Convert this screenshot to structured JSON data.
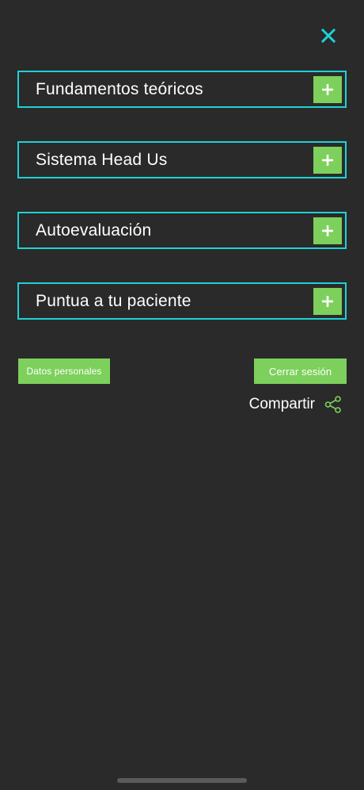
{
  "header": {
    "close_icon": "close-icon",
    "accent_color": "#1ed1d6"
  },
  "menu": {
    "items": [
      {
        "label": "Fundamentos teóricos",
        "icon": "plus-icon"
      },
      {
        "label": "Sistema Head Us",
        "icon": "plus-icon"
      },
      {
        "label": "Autoevaluación",
        "icon": "plus-icon"
      },
      {
        "label": "Puntua a tu paciente",
        "icon": "plus-icon"
      }
    ],
    "border_color": "#1ed1d6",
    "plus_color": "#7dd05c"
  },
  "actions": {
    "personal_data_label": "Datos personales",
    "logout_label": "Cerrar sesión",
    "button_color": "#7dd05c"
  },
  "share": {
    "label": "Compartir",
    "icon": "share-icon",
    "icon_color": "#7dd05c"
  },
  "background_color": "#2a2a2a"
}
